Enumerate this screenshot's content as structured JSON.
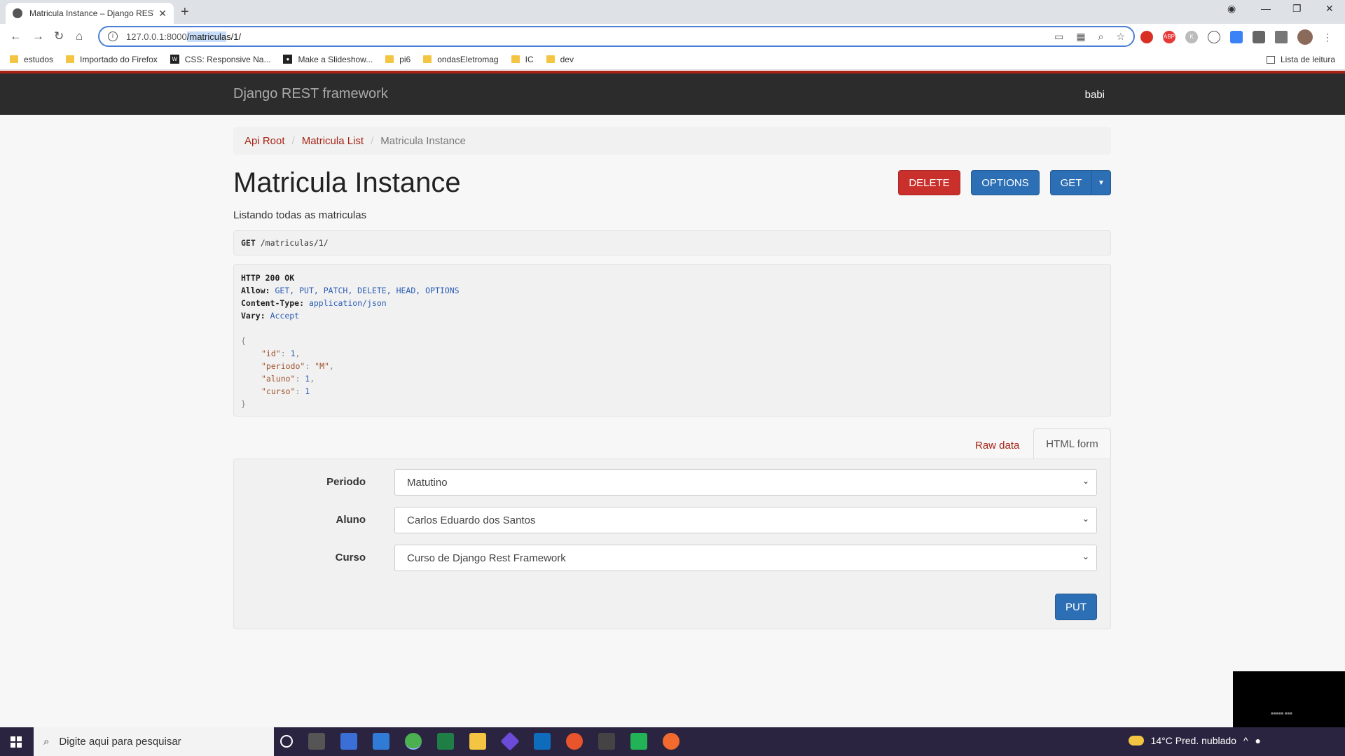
{
  "browser": {
    "tab_title": "Matricula Instance – Django REST",
    "url_host": "127.0.0.1:8000",
    "url_selected": "/matricula",
    "url_rest": "s/1/",
    "bookmarks": [
      {
        "label": "estudos"
      },
      {
        "label": "Importado do Firefox"
      },
      {
        "label": "CSS: Responsive Na..."
      },
      {
        "label": "Make a Slideshow..."
      },
      {
        "label": "pi6"
      },
      {
        "label": "ondasEletromag"
      },
      {
        "label": "IC"
      },
      {
        "label": "dev"
      }
    ],
    "reading_list": "Lista de leitura"
  },
  "navbar": {
    "brand": "Django REST framework",
    "user": "babi"
  },
  "breadcrumb": {
    "root": "Api Root",
    "list": "Matricula List",
    "active": "Matricula Instance"
  },
  "page": {
    "title": "Matricula Instance",
    "description": "Listando todas as matriculas"
  },
  "actions": {
    "delete": "DELETE",
    "options": "OPTIONS",
    "get": "GET"
  },
  "request": {
    "method": "GET",
    "path": "/matriculas/1/"
  },
  "response": {
    "status": "HTTP 200 OK",
    "allow_key": "Allow:",
    "allow_val": "GET, PUT, PATCH, DELETE, HEAD, OPTIONS",
    "ctype_key": "Content-Type:",
    "ctype_val": "application/json",
    "vary_key": "Vary:",
    "vary_val": "Accept",
    "json_open": "{",
    "json_close": "}",
    "fields": [
      {
        "key": "\"id\"",
        "value": "1",
        "type": "num",
        "comma": ","
      },
      {
        "key": "\"periodo\"",
        "value": "\"M\"",
        "type": "str",
        "comma": ","
      },
      {
        "key": "\"aluno\"",
        "value": "1",
        "type": "num",
        "comma": ","
      },
      {
        "key": "\"curso\"",
        "value": "1",
        "type": "num",
        "comma": ""
      }
    ]
  },
  "form_tabs": {
    "raw": "Raw data",
    "html": "HTML form"
  },
  "form": {
    "periodo_label": "Periodo",
    "periodo_value": "Matutino",
    "aluno_label": "Aluno",
    "aluno_value": "Carlos Eduardo dos Santos",
    "curso_label": "Curso",
    "curso_value": "Curso de Django Rest Framework",
    "submit": "PUT"
  },
  "taskbar": {
    "search_placeholder": "Digite aqui para pesquisar",
    "weather": "14°C  Pred. nublado"
  },
  "colors": {
    "accent_red": "#a62315",
    "primary_blue": "#2c6fb5",
    "danger": "#c9302c"
  }
}
